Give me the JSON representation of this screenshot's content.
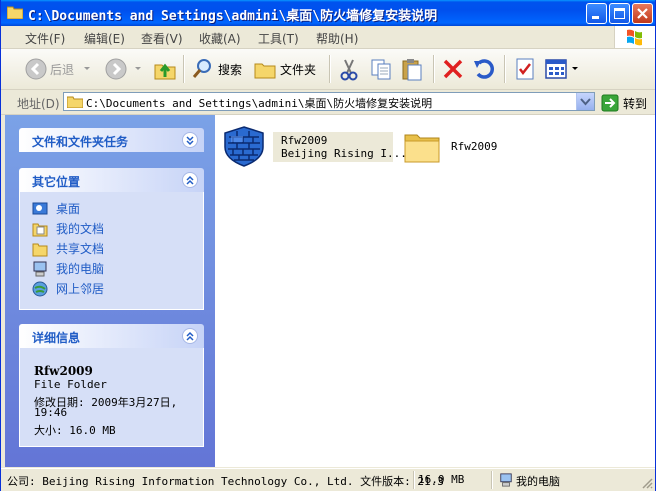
{
  "window": {
    "title": "C:\\Documents and Settings\\admini\\桌面\\防火墙修复安装说明"
  },
  "menu": [
    "文件(F)",
    "编辑(E)",
    "查看(V)",
    "收藏(A)",
    "工具(T)",
    "帮助(H)"
  ],
  "toolbar": {
    "back": "后退",
    "search": "搜索",
    "folders": "文件夹"
  },
  "address": {
    "label": "地址(D)",
    "value": "C:\\Documents and Settings\\admini\\桌面\\防火墙修复安装说明",
    "go": "转到"
  },
  "tasks": {
    "file_folder_tasks": "文件和文件夹任务",
    "other_places": {
      "title": "其它位置",
      "items": [
        "桌面",
        "我的文档",
        "共享文档",
        "我的电脑",
        "网上邻居"
      ]
    },
    "details": {
      "title": "详细信息",
      "name": "Rfw2009",
      "type": "File Folder",
      "modified_label": "修改日期: 2009年3月27日,",
      "modified_time": "19:46",
      "size": "大小: 16.0 MB"
    }
  },
  "files": [
    {
      "name": "Rfw2009",
      "company": "Beijing Rising I...",
      "icon": "firewall-installer-icon"
    },
    {
      "name": "Rfw2009",
      "icon": "folder-icon"
    }
  ],
  "status": {
    "company": "公司: Beijing Rising Information Technology Co., Ltd. 文件版本: 21.3",
    "size": "16.0 MB",
    "location": "我的电脑"
  }
}
